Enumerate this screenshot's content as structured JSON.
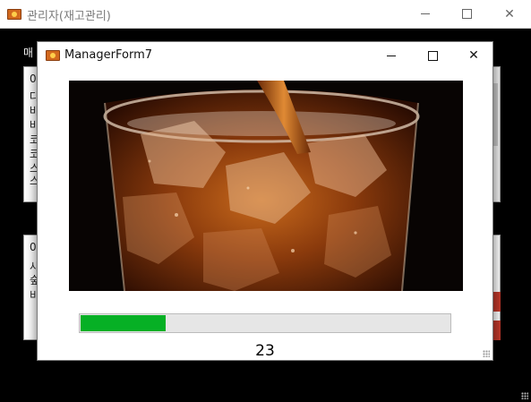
{
  "outer_window": {
    "title": "관리자(재고관리)",
    "background_label": "매",
    "top_panel_lines": [
      "0",
      "다",
      "바",
      "바",
      "코",
      "코",
      "스",
      "스"
    ],
    "bottom_panel_lines": [
      "0",
      "사",
      "숲",
      "비"
    ]
  },
  "inner_window": {
    "title": "ManagerForm7",
    "image_subject": "iced cola glass",
    "progress": {
      "value": 23,
      "max": 100,
      "fraction": 0.23,
      "color": "#06b025"
    },
    "progress_label": "23"
  },
  "icons": [
    "app-icon",
    "minimize-icon",
    "maximize-icon",
    "close-icon",
    "size-grip-icon"
  ]
}
